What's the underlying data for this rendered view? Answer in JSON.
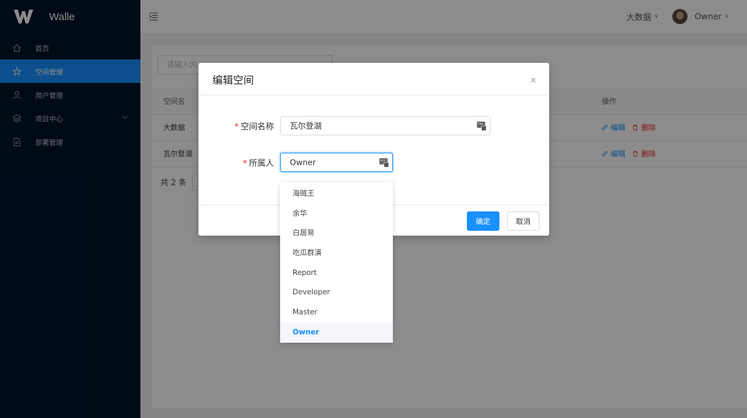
{
  "app": {
    "name": "Walle"
  },
  "sidebar": {
    "items": [
      {
        "label": "首页",
        "icon": "home-icon"
      },
      {
        "label": "空间管理",
        "icon": "star-icon",
        "active": true
      },
      {
        "label": "用户管理",
        "icon": "user-icon"
      },
      {
        "label": "项目中心",
        "icon": "layers-icon",
        "expandable": true
      },
      {
        "label": "部署管理",
        "icon": "file-icon"
      }
    ]
  },
  "header": {
    "space_label": "大数据",
    "user_label": "Owner"
  },
  "content": {
    "search_placeholder": "请输入内",
    "columns": {
      "name": "空间名",
      "operation": "操作"
    },
    "rows": [
      {
        "name": "大数据",
        "edit": "编辑",
        "delete": "删除"
      },
      {
        "name": "瓦尔登湖",
        "edit": "编辑",
        "delete": "删除"
      }
    ],
    "total": "共 2 条"
  },
  "modal": {
    "title": "编辑空间",
    "close": "×",
    "fields": {
      "space_name": {
        "label": "空间名称",
        "value": "瓦尔登湖"
      },
      "owner": {
        "label": "所属人",
        "value": "Owner"
      }
    },
    "confirm": "确定",
    "cancel": "取消"
  },
  "dropdown": {
    "options": [
      "海贼王",
      "余华",
      "白居易",
      "吃瓜群演",
      "Report",
      "Developer",
      "Master",
      "Owner"
    ],
    "selected": "Owner"
  },
  "colors": {
    "primary": "#1890ff",
    "danger": "#f5222d",
    "sidebar_bg": "#001529"
  }
}
